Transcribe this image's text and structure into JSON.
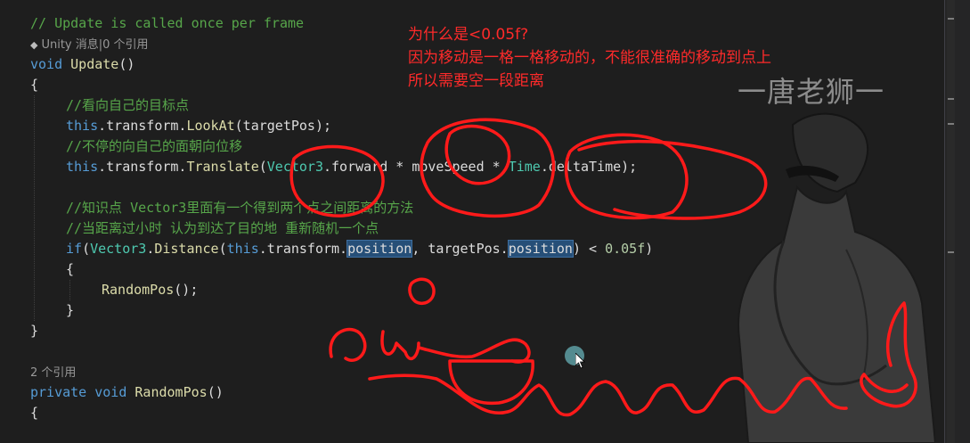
{
  "editor": {
    "lines": [
      {
        "indent": 0,
        "tokens": [
          {
            "t": "// Update is called once per frame",
            "c": "cm"
          }
        ]
      },
      {
        "indent": 0,
        "lens": true,
        "tokens": [
          {
            "t": "Unity 消息|0 个引用",
            "c": "lens"
          }
        ]
      },
      {
        "indent": 0,
        "tokens": [
          {
            "t": "void",
            "c": "kw"
          },
          {
            "t": " ",
            "c": "pl"
          },
          {
            "t": "Update",
            "c": "fn"
          },
          {
            "t": "()",
            "c": "pl"
          }
        ]
      },
      {
        "indent": 0,
        "tokens": [
          {
            "t": "{",
            "c": "pl"
          }
        ]
      },
      {
        "indent": 2,
        "tokens": [
          {
            "t": "//看向自己的目标点",
            "c": "cm"
          }
        ]
      },
      {
        "indent": 2,
        "tokens": [
          {
            "t": "this",
            "c": "kw"
          },
          {
            "t": ".transform.",
            "c": "pl"
          },
          {
            "t": "LookAt",
            "c": "fn"
          },
          {
            "t": "(targetPos);",
            "c": "pl"
          }
        ]
      },
      {
        "indent": 2,
        "tokens": [
          {
            "t": "//不停的向自己的面朝向位移",
            "c": "cm"
          }
        ]
      },
      {
        "indent": 2,
        "tokens": [
          {
            "t": "this",
            "c": "kw"
          },
          {
            "t": ".transform.",
            "c": "pl"
          },
          {
            "t": "Translate",
            "c": "fn"
          },
          {
            "t": "(",
            "c": "pl"
          },
          {
            "t": "Vector3",
            "c": "ty"
          },
          {
            "t": ".forward * moveSpeed * ",
            "c": "pl"
          },
          {
            "t": "Time",
            "c": "ty"
          },
          {
            "t": ".deltaTime);",
            "c": "pl"
          }
        ]
      },
      {
        "indent": 0,
        "tokens": []
      },
      {
        "indent": 2,
        "tokens": [
          {
            "t": "//知识点 Vector3里面有一个得到两个点之间距离的方法",
            "c": "cm"
          }
        ]
      },
      {
        "indent": 2,
        "tokens": [
          {
            "t": "//当距离过小时 认为到达了目的地 重新随机一个点",
            "c": "cm"
          }
        ]
      },
      {
        "indent": 2,
        "tokens": [
          {
            "t": "if",
            "c": "kw"
          },
          {
            "t": "(",
            "c": "pl"
          },
          {
            "t": "Vector3",
            "c": "ty"
          },
          {
            "t": ".",
            "c": "pl"
          },
          {
            "t": "Distance",
            "c": "fn"
          },
          {
            "t": "(",
            "c": "pl"
          },
          {
            "t": "this",
            "c": "kw"
          },
          {
            "t": ".transform.",
            "c": "pl"
          },
          {
            "t": "position",
            "c": "hl"
          },
          {
            "t": ", targetPos.",
            "c": "pl"
          },
          {
            "t": "position",
            "c": "hl"
          },
          {
            "t": ") < ",
            "c": "pl"
          },
          {
            "t": "0.05f",
            "c": "nm"
          },
          {
            "t": ")",
            "c": "pl"
          }
        ]
      },
      {
        "indent": 2,
        "tokens": [
          {
            "t": "{",
            "c": "pl"
          }
        ]
      },
      {
        "indent": 4,
        "tokens": [
          {
            "t": "RandomPos",
            "c": "fn"
          },
          {
            "t": "();",
            "c": "pl"
          }
        ]
      },
      {
        "indent": 2,
        "tokens": [
          {
            "t": "}",
            "c": "pl"
          }
        ]
      },
      {
        "indent": 0,
        "tokens": [
          {
            "t": "}",
            "c": "pl"
          }
        ]
      },
      {
        "indent": 0,
        "tokens": []
      },
      {
        "indent": 0,
        "lens": true,
        "tokens": [
          {
            "t": "2 个引用",
            "c": "lens"
          }
        ]
      },
      {
        "indent": 0,
        "tokens": [
          {
            "t": "private",
            "c": "kw"
          },
          {
            "t": " ",
            "c": "pl"
          },
          {
            "t": "void",
            "c": "kw"
          },
          {
            "t": " ",
            "c": "pl"
          },
          {
            "t": "RandomPos",
            "c": "fn"
          },
          {
            "t": "()",
            "c": "pl"
          }
        ]
      },
      {
        "indent": 0,
        "tokens": [
          {
            "t": "{",
            "c": "pl"
          }
        ]
      }
    ]
  },
  "annotation": {
    "line1": "为什么是<0.05f?",
    "line2": "因为移动是一格一格移动的，不能很准确的移动到点上",
    "line3": "所以需要空一段距离"
  },
  "watermark": "一唐老狮一",
  "colors": {
    "background": "#1e1e1e",
    "keyword": "#569cd6",
    "method": "#dcdcaa",
    "type": "#4ec9b0",
    "comment": "#57a64a",
    "number": "#b5cea8",
    "annotation": "#ff2a2a",
    "highlight": "#264f78"
  },
  "icons": {
    "codelens": "unity-cube-icon",
    "cursor": "mouse-pointer-icon"
  }
}
